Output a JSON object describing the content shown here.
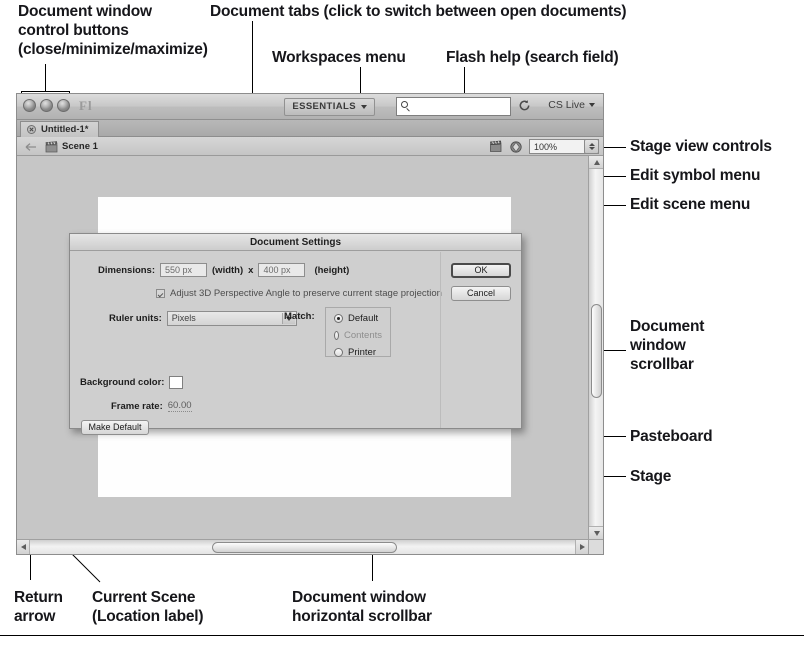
{
  "annotations": {
    "top_left": "Document window\ncontrol buttons\n(close/minimize/maximize)",
    "doc_tabs": "Document tabs (click to switch between open documents)",
    "workspaces": "Workspaces menu",
    "flash_help": "Flash help (search field)",
    "stage_view_controls": "Stage view controls",
    "edit_symbol_menu": "Edit symbol menu",
    "edit_scene_menu": "Edit scene menu",
    "doc_window_scrollbar": "Document\nwindow\nscrollbar",
    "pasteboard": "Pasteboard",
    "stage": "Stage",
    "return_arrow": "Return\narrow",
    "current_scene": "Current Scene\n(Location label)",
    "horizontal_scrollbar": "Document window\nhorizontal scrollbar"
  },
  "app": {
    "logo": "Fl",
    "workspace_label": "ESSENTIALS",
    "search_placeholder": "",
    "search_value": "",
    "cs_live_label": "CS Live",
    "search_icon": "search-icon",
    "refresh_icon": "refresh-icon",
    "caret_icon": "chevron-down-icon"
  },
  "tabs": [
    {
      "label": "Untitled-1*",
      "close_icon": "close-icon",
      "active": true
    }
  ],
  "edit_bar": {
    "back_icon": "back-arrow-icon",
    "scene_icon": "clapperboard-icon",
    "scene_label": "Scene 1",
    "edit_scene_icon": "edit-scene-icon",
    "edit_symbol_icon": "edit-symbol-icon",
    "zoom_value": "100%"
  },
  "dialog": {
    "title": "Document Settings",
    "dimensions_label": "Dimensions:",
    "width_value": "550 px",
    "width_suffix": "(width)",
    "times": "x",
    "height_value": "400 px",
    "height_suffix": "(height)",
    "adjust_3d_label": "Adjust 3D Perspective Angle to preserve current stage projection",
    "adjust_3d_checked": true,
    "ruler_units_label": "Ruler units:",
    "ruler_units_value": "Pixels",
    "match_label": "Match:",
    "match_options": [
      {
        "label": "Default",
        "selected": true
      },
      {
        "label": "Contents",
        "selected": false
      },
      {
        "label": "Printer",
        "selected": false
      }
    ],
    "background_color_label": "Background color:",
    "background_color_value": "#ffffff",
    "frame_rate_label": "Frame rate:",
    "frame_rate_value": "60.00",
    "make_default_label": "Make Default",
    "ok_label": "OK",
    "cancel_label": "Cancel"
  },
  "colors": {
    "window_chrome": "#c6c6c6",
    "stage_white": "#fefefe",
    "pasteboard_gray": "#c6c6c6",
    "dialog_gray": "#cfcfcf",
    "annotation_text": "#16161a"
  }
}
